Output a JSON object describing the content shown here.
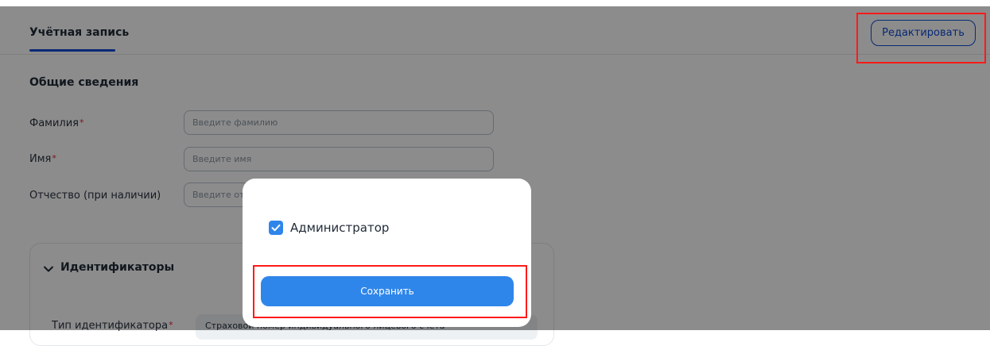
{
  "tabs": {
    "account_label": "Учётная запись"
  },
  "header": {
    "edit_button_label": "Редактировать"
  },
  "general": {
    "section_title": "Общие сведения",
    "fields": [
      {
        "label": "Фамилия",
        "required": "*",
        "placeholder": "Введите фамилию"
      },
      {
        "label": "Имя",
        "required": "*",
        "placeholder": "Введите имя"
      },
      {
        "label": "Отчество (при наличии)",
        "required": "",
        "placeholder": "Введите отчество"
      }
    ]
  },
  "identifiers": {
    "title": "Идентификаторы",
    "type_label": "Тип идентификатора",
    "type_required": "*",
    "type_value": "Страховой номер индивидуального лицевого счёта"
  },
  "modal": {
    "checkbox_label": "Администратор",
    "checkbox_checked": true,
    "save_button_label": "Сохранить"
  },
  "colors": {
    "accent": "#0d4cd3",
    "primary_button": "#2f86ea",
    "highlight_box": "#ff1a1a",
    "required_mark": "#e0243f"
  }
}
